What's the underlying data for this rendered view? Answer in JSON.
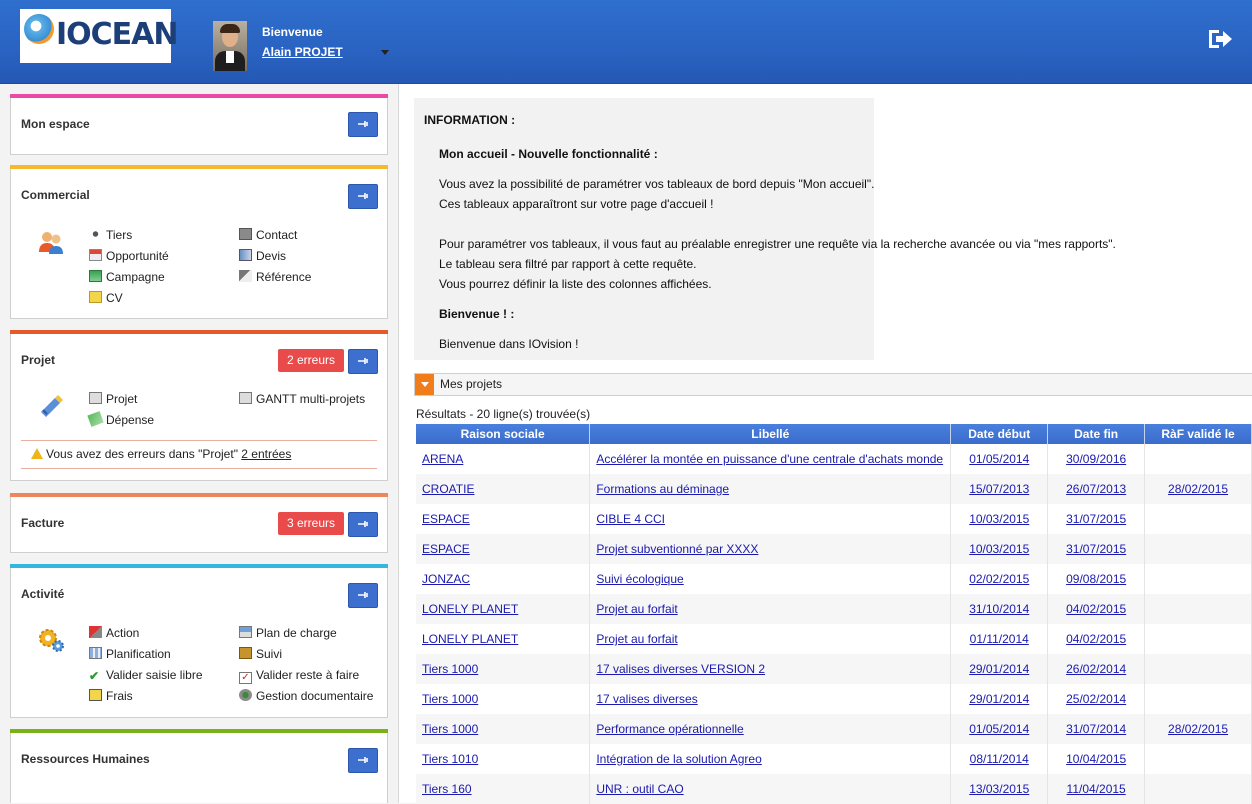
{
  "header": {
    "logo_text": "IOCEAN",
    "welcome": "Bienvenue",
    "user_name": "Alain PROJET",
    "icons": {
      "logout": "logout-icon",
      "avatar": "user-avatar"
    },
    "colors": {
      "bar": "#2a63c2"
    }
  },
  "sidebar": {
    "mon_espace": {
      "title": "Mon espace",
      "color": "#e94aa6"
    },
    "commercial": {
      "title": "Commercial",
      "color": "#f5b82e",
      "items": [
        "Tiers",
        "Contact",
        "Opportunité",
        "Devis",
        "Campagne",
        "Référence",
        "CV"
      ]
    },
    "projet": {
      "title": "Projet",
      "color": "#e55a2a",
      "errors": "2 erreurs",
      "items": [
        "Projet",
        "GANTT multi-projets",
        "Dépense"
      ],
      "error_text": "Vous avez des erreurs dans \"Projet\"",
      "error_link": "2 entrées"
    },
    "facture": {
      "title": "Facture",
      "color": "#f0845a",
      "errors": "3 erreurs"
    },
    "activite": {
      "title": "Activité",
      "color": "#33b6e0",
      "items": [
        "Action",
        "Plan de charge",
        "Planification",
        "Suivi",
        "Valider saisie libre",
        "Valider reste à faire",
        "Frais",
        "Gestion documentaire"
      ]
    },
    "rh": {
      "title": "Ressources Humaines",
      "color": "#7ab317"
    }
  },
  "info": {
    "heading": "INFORMATION :",
    "sub1": "Mon accueil - Nouvelle fonctionnalité :",
    "lines": [
      "Vous avez la possibilité de paramétrer vos tableaux de bord depuis \"Mon accueil\".",
      "Ces tableaux apparaîtront sur votre page d'accueil !",
      "Pour paramétrer vos tableaux, il vous faut au préalable enregistrer une requête via la recherche avancée ou via \"mes rapports\".",
      "Le tableau sera filtré par rapport à cette requête.",
      "Vous pourrez définir la liste des colonnes affichées."
    ],
    "sub2": "Bienvenue ! :",
    "welcome_line": "Bienvenue dans IOvision !"
  },
  "projects": {
    "title": "Mes projets",
    "results": "Résultats - 20 ligne(s) trouvée(s)",
    "columns": [
      "Raison sociale",
      "Libellé",
      "Date début",
      "Date fin",
      "RàF validé le"
    ],
    "rows": [
      [
        "ARENA",
        "Accélérer la montée en puissance d'une centrale d'achats monde",
        "01/05/2014",
        "30/09/2016",
        ""
      ],
      [
        "CROATIE",
        "Formations au déminage",
        "15/07/2013",
        "26/07/2013",
        "28/02/2015"
      ],
      [
        "ESPACE",
        "CIBLE 4 CCI",
        "10/03/2015",
        "31/07/2015",
        ""
      ],
      [
        "ESPACE",
        "Projet subventionné par XXXX",
        "10/03/2015",
        "31/07/2015",
        ""
      ],
      [
        "JONZAC",
        "Suivi écologique",
        "02/02/2015",
        "09/08/2015",
        ""
      ],
      [
        "LONELY PLANET",
        "Projet au forfait",
        "31/10/2014",
        "04/02/2015",
        ""
      ],
      [
        "LONELY PLANET",
        "Projet au forfait",
        "01/11/2014",
        "04/02/2015",
        ""
      ],
      [
        "Tiers 1000",
        "17 valises diverses VERSION 2",
        "29/01/2014",
        "26/02/2014",
        ""
      ],
      [
        "Tiers 1000",
        "17 valises diverses",
        "29/01/2014",
        "25/02/2014",
        ""
      ],
      [
        "Tiers 1000",
        "Performance opérationnelle",
        "01/05/2014",
        "31/07/2014",
        "28/02/2015"
      ],
      [
        "Tiers 1010",
        "Intégration de la solution Agreo",
        "08/11/2014",
        "10/04/2015",
        ""
      ],
      [
        "Tiers 160",
        "UNR : outil CAO",
        "13/03/2015",
        "11/04/2015",
        ""
      ]
    ]
  }
}
